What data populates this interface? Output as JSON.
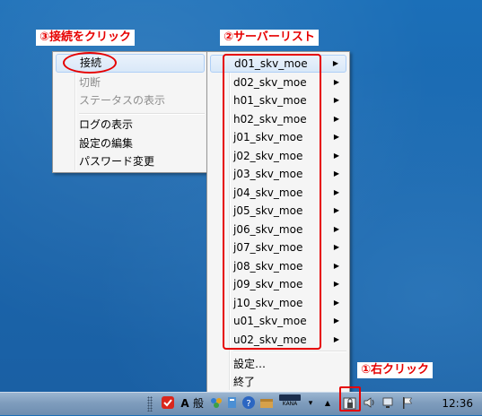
{
  "callouts": {
    "step3": "③接続をクリック",
    "step2": "②サーバーリスト",
    "step1": "①右クリック"
  },
  "context_menu": {
    "items": [
      {
        "label": "接続",
        "state": "highlighted"
      },
      {
        "label": "切断",
        "state": "disabled"
      },
      {
        "label": "ステータスの表示",
        "state": "disabled"
      },
      {
        "label": "ログの表示",
        "state": "enabled"
      },
      {
        "label": "設定の編集",
        "state": "enabled"
      },
      {
        "label": "パスワード変更",
        "state": "enabled"
      }
    ]
  },
  "server_menu": {
    "servers": [
      "d01_skv_moe",
      "d02_skv_moe",
      "h01_skv_moe",
      "h02_skv_moe",
      "j01_skv_moe",
      "j02_skv_moe",
      "j03_skv_moe",
      "j04_skv_moe",
      "j05_skv_moe",
      "j06_skv_moe",
      "j07_skv_moe",
      "j08_skv_moe",
      "j09_skv_moe",
      "j10_skv_moe",
      "u01_skv_moe",
      "u02_skv_moe"
    ],
    "footer": [
      "設定…",
      "終了"
    ],
    "submenu_arrow": "▶"
  },
  "taskbar": {
    "ime_mode": "A",
    "ime_label": "般",
    "kana_label": "KANA",
    "clock": "12:36"
  },
  "colors": {
    "annotation": "#e60000",
    "highlight": "#d9e8f8"
  }
}
